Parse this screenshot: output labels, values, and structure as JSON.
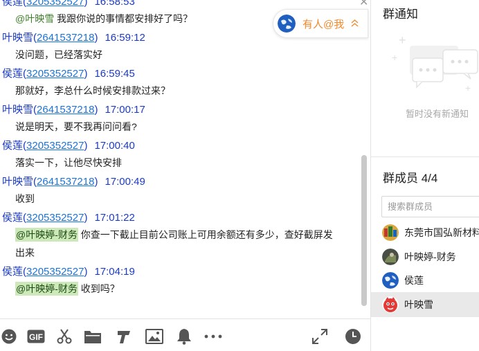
{
  "messages": [
    {
      "sender": "侯莲",
      "qq": "3205352527",
      "time": "16:58:53",
      "lines": [
        {
          "mention": "@叶映雪",
          "text": " 我跟你说的事情都安排好了吗？"
        }
      ]
    },
    {
      "sender": "叶映雪",
      "qq": "2641537218",
      "time": "16:59:12",
      "lines": [
        {
          "text": "没问题，已经落实好"
        }
      ]
    },
    {
      "sender": "侯莲",
      "qq": "3205352527",
      "time": "16:59:45",
      "lines": [
        {
          "text": "那就好，李总什么时候安排款过来？"
        }
      ]
    },
    {
      "sender": "叶映雪",
      "qq": "2641537218",
      "time": "17:00:17",
      "lines": [
        {
          "text": "说是明天，要不我再问问看?"
        }
      ]
    },
    {
      "sender": "侯莲",
      "qq": "3205352527",
      "time": "17:00:40",
      "lines": [
        {
          "text": "落实一下，让他尽快安排"
        }
      ]
    },
    {
      "sender": "叶映雪",
      "qq": "2641537218",
      "time": "17:00:49",
      "lines": [
        {
          "text": "收到"
        }
      ]
    },
    {
      "sender": "侯莲",
      "qq": "3205352527",
      "time": "17:01:22",
      "lines": [
        {
          "mention": "@叶映婷-财务",
          "text": " 你查一下截止目前公司账上可用余额还有多少，查好截屏发"
        },
        {
          "text": "出来"
        }
      ]
    },
    {
      "sender": "侯莲",
      "qq": "3205352527",
      "time": "17:04:19",
      "lines": [
        {
          "mention": "@叶映婷-财务",
          "text": " 收到吗？"
        }
      ]
    }
  ],
  "at_me_label": "有人@我",
  "toolbar": {
    "icons": [
      "emoji-icon",
      "gif-icon",
      "scissors-icon",
      "folder-icon",
      "font-icon",
      "image-icon",
      "bell-icon",
      "more-icon",
      "expand-icon",
      "history-clock-icon"
    ],
    "gif_text": "GIF"
  },
  "notice": {
    "title": "群通知",
    "empty": "暂时没有新通知"
  },
  "members": {
    "title": "群成员 4/4",
    "search_placeholder": "搜索群成员",
    "list": [
      {
        "name": "东莞市国弘新材料",
        "avatar": "company-avatar"
      },
      {
        "name": "叶映婷-财务",
        "avatar": "dark-avatar"
      },
      {
        "name": "侯莲",
        "avatar": "earth-avatar"
      },
      {
        "name": "叶映雪",
        "avatar": "red-face-avatar",
        "selected": true
      }
    ]
  },
  "colors": {
    "sender": "#1a3ac8",
    "qq_link": "#1a73d9",
    "mention_bg": "#cde8b9",
    "at_me": "#f08a2c"
  }
}
